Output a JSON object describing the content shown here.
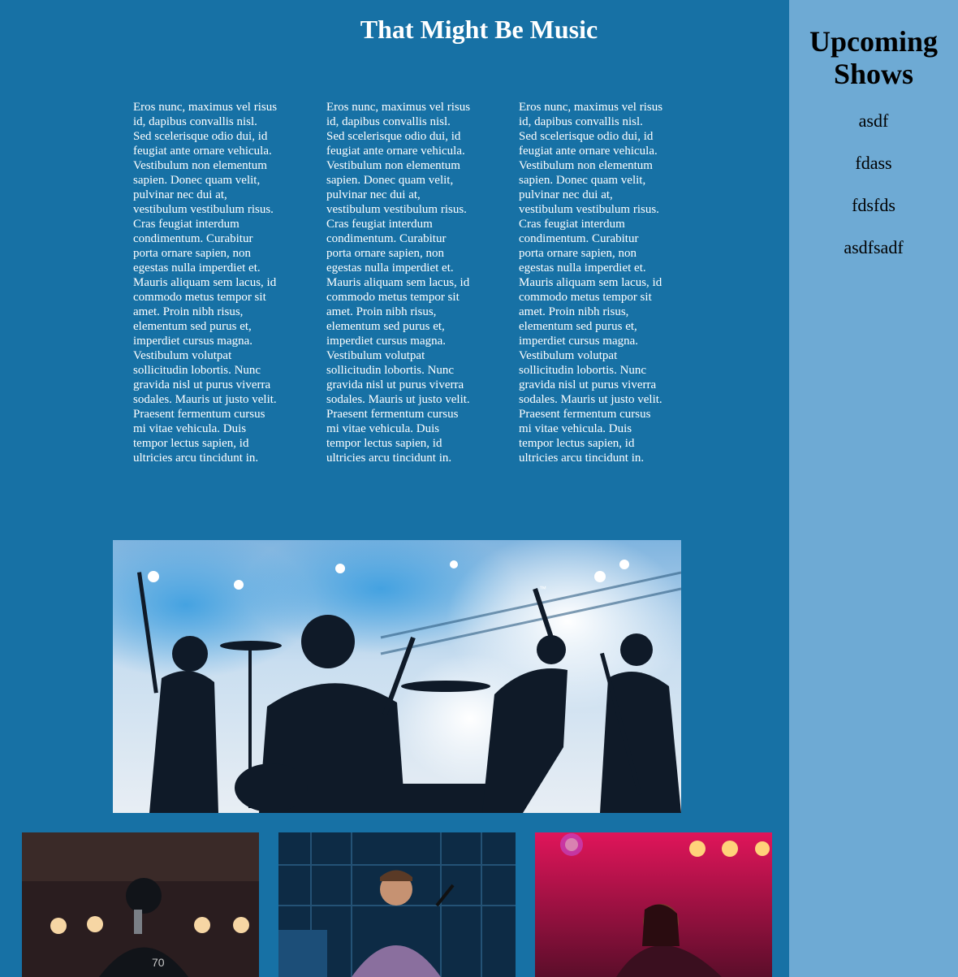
{
  "header": {
    "title": "That Might Be Music"
  },
  "columns": [
    {
      "text": "Eros nunc, maximus vel risus id, dapibus convallis nisl. Sed scelerisque odio dui, id feugiat ante ornare vehicula. Vestibulum non elementum sapien. Donec quam velit, pulvinar nec dui at, vestibulum vestibulum risus. Cras feugiat interdum condimentum. Curabitur porta ornare sapien, non egestas nulla imperdiet et. Mauris aliquam sem lacus, id commodo metus tempor sit amet. Proin nibh risus, elementum sed purus et, imperdiet cursus magna. Vestibulum volutpat sollicitudin lobortis. Nunc gravida nisl ut purus viverra sodales. Mauris ut justo velit. Praesent fermentum cursus mi vitae vehicula. Duis tempor lectus sapien, id ultricies arcu tincidunt in."
    },
    {
      "text": "Eros nunc, maximus vel risus id, dapibus convallis nisl. Sed scelerisque odio dui, id feugiat ante ornare vehicula. Vestibulum non elementum sapien. Donec quam velit, pulvinar nec dui at, vestibulum vestibulum risus. Cras feugiat interdum condimentum. Curabitur porta ornare sapien, non egestas nulla imperdiet et. Mauris aliquam sem lacus, id commodo metus tempor sit amet. Proin nibh risus, elementum sed purus et, imperdiet cursus magna. Vestibulum volutpat sollicitudin lobortis. Nunc gravida nisl ut purus viverra sodales. Mauris ut justo velit. Praesent fermentum cursus mi vitae vehicula. Duis tempor lectus sapien, id ultricies arcu tincidunt in."
    },
    {
      "text": "Eros nunc, maximus vel risus id, dapibus convallis nisl. Sed scelerisque odio dui, id feugiat ante ornare vehicula. Vestibulum non elementum sapien. Donec quam velit, pulvinar nec dui at, vestibulum vestibulum risus. Cras feugiat interdum condimentum. Curabitur porta ornare sapien, non egestas nulla imperdiet et. Mauris aliquam sem lacus, id commodo metus tempor sit amet. Proin nibh risus, elementum sed purus et, imperdiet cursus magna. Vestibulum volutpat sollicitudin lobortis. Nunc gravida nisl ut purus viverra sodales. Mauris ut justo velit. Praesent fermentum cursus mi vitae vehicula. Duis tempor lectus sapien, id ultricies arcu tincidunt in."
    }
  ],
  "sidebar": {
    "title": "Upcoming Shows",
    "shows": [
      "asdf",
      "fdass",
      "fdsfds",
      "asdfsadf"
    ]
  },
  "colors": {
    "main_bg": "#1771a5",
    "sidebar_bg": "#6eaad4",
    "text_light": "#ffffff",
    "text_dark": "#000000"
  },
  "hero_image": {
    "icon": "band-concert-photo",
    "mark": "™"
  },
  "photos": [
    {
      "icon": "singer-microphone-photo"
    },
    {
      "icon": "keyboardist-photo"
    },
    {
      "icon": "guitarist-red-lights-photo"
    }
  ]
}
